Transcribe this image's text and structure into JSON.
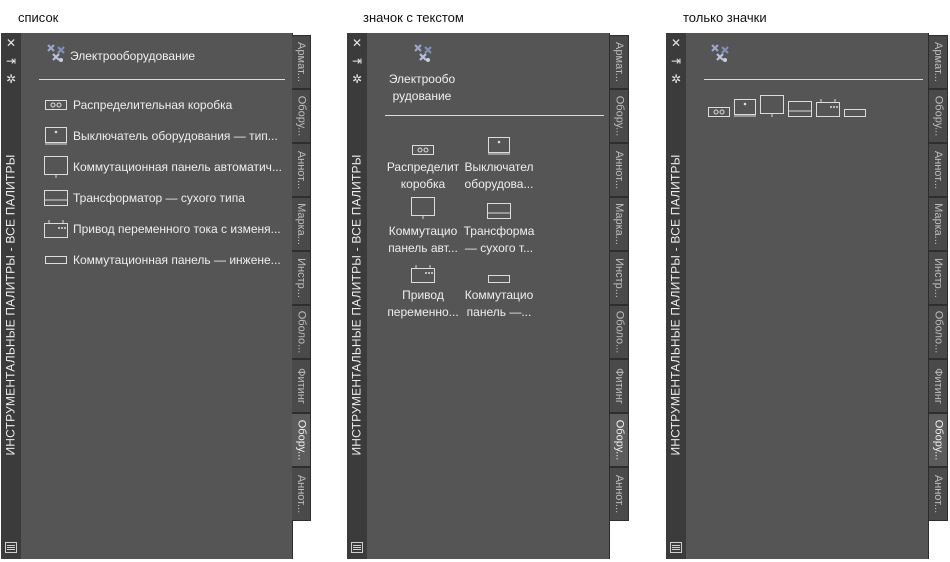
{
  "captions": [
    "список",
    "значок с текстом",
    "только значки"
  ],
  "palette_title": "ИНСТРУМЕНТАЛЬНЫЕ ПАЛИТРЫ - ВСЕ ПАЛИТРЫ",
  "titlebar_icons": [
    "close-icon",
    "auto-hide-icon",
    "properties-icon"
  ],
  "tabs": [
    "Армат...",
    "Обору...",
    "Аннот...",
    "Марка...",
    "Инстр...",
    "Оболо...",
    "Фитинг",
    "Обору...",
    "Аннот..."
  ],
  "active_tab_index": 7,
  "group": {
    "label": "Электрооборудование",
    "label_wrapped": [
      "Электрообо",
      "рудование"
    ]
  },
  "list_items": [
    {
      "label": "Распределительная коробка",
      "icon": "junction-box-icon"
    },
    {
      "label": "Выключатель  оборудования — тип...",
      "icon": "equipment-switch-icon"
    },
    {
      "label": "Коммутационная  панель автоматич...",
      "icon": "switchboard-icon"
    },
    {
      "label": "Трансформатор — сухого типа",
      "icon": "transformer-icon"
    },
    {
      "label": "Привод  переменного тока с изменя...",
      "icon": "ac-drive-icon"
    },
    {
      "label": "Коммутационная  панель — инжене...",
      "icon": "panel-icon"
    }
  ],
  "grid_items": [
    {
      "line1": "Распределит",
      "line2": "коробка"
    },
    {
      "line1": "Выключател",
      "line2": "оборудова..."
    },
    {
      "line1": "Коммутацио",
      "line2": "панель  авт..."
    },
    {
      "line1": "Трансформа",
      "line2": "— сухого т..."
    },
    {
      "line1": "Привод",
      "line2": "переменно..."
    },
    {
      "line1": "Коммутацио",
      "line2": "панель —..."
    }
  ],
  "colors": {
    "panel_bg": "#555555",
    "titlebar_bg": "#3b3b3b",
    "text": "#eeeeee"
  }
}
